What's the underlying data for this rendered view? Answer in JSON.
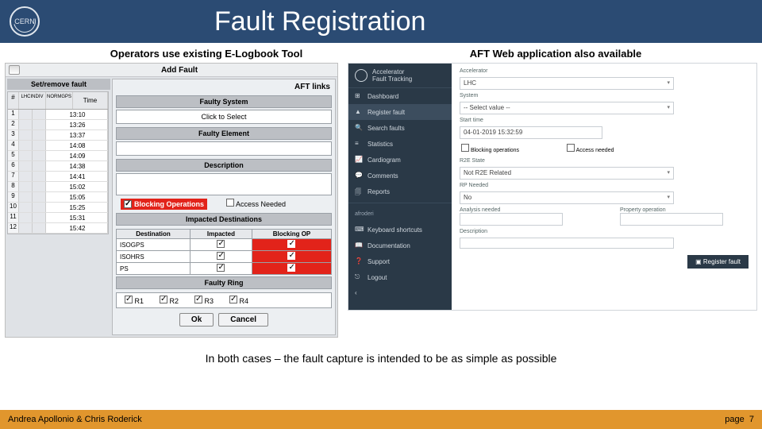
{
  "header": {
    "logo_text": "CERN",
    "title": "Fault Registration"
  },
  "sub": {
    "left": "Operators use existing E-Logbook Tool",
    "right": "AFT Web application also available"
  },
  "elog": {
    "window_title": "Add Fault",
    "aft_links": "AFT links",
    "set_label": "Set/remove fault",
    "grid_head": {
      "num": "#",
      "col1": "LHCINDIV",
      "col2": "NORMGPS",
      "time": "Time"
    },
    "rows": [
      {
        "n": "1",
        "t": "13:10"
      },
      {
        "n": "2",
        "t": "13:26"
      },
      {
        "n": "3",
        "t": "13:37"
      },
      {
        "n": "4",
        "t": "14:08"
      },
      {
        "n": "5",
        "t": "14:09"
      },
      {
        "n": "6",
        "t": "14:38"
      },
      {
        "n": "7",
        "t": "14:41"
      },
      {
        "n": "8",
        "t": "15:02"
      },
      {
        "n": "9",
        "t": "15:05"
      },
      {
        "n": "10",
        "t": "15:25"
      },
      {
        "n": "11",
        "t": "15:31"
      },
      {
        "n": "12",
        "t": "15:42"
      }
    ],
    "faulty_system": "Faulty System",
    "click_select": "Click to Select",
    "faulty_element": "Faulty Element",
    "description": "Description",
    "blocking": "Blocking Operations",
    "access": "Access Needed",
    "impacted": "Impacted Destinations",
    "dest_h": {
      "d": "Destination",
      "i": "Impacted",
      "b": "Blocking OP"
    },
    "dests": [
      "ISOGPS",
      "ISOHRS",
      "PS"
    ],
    "faulty_ring": "Faulty Ring",
    "rings": [
      "R1",
      "R2",
      "R3",
      "R4"
    ],
    "ok": "Ok",
    "cancel": "Cancel"
  },
  "aft": {
    "brand": "Accelerator\nFault Tracking",
    "accel": "LHC",
    "menu": [
      "Dashboard",
      "Register fault",
      "Search faults",
      "Statistics",
      "Cardiogram",
      "Comments",
      "Reports"
    ],
    "user": "afroderi",
    "menu2": [
      "Keyboard shortcuts",
      "Documentation",
      "Support",
      "Logout"
    ],
    "labels": {
      "accelerator": "Accelerator",
      "system": "System",
      "select": "-- Select value --",
      "start": "Start time",
      "start_val": "04-01-2019 15:32:59",
      "block": "Blocking operations",
      "access": "Access needed",
      "r2e": "R2E State",
      "r2e_val": "Not R2E Related",
      "rp": "RP Needed",
      "no": "No",
      "ar": "Analysis needed",
      "po": "Property operation",
      "desc": "Description"
    },
    "register": "Register fault"
  },
  "caption": "In both cases – the fault capture is intended to be as simple as possible",
  "footer": {
    "authors": "Andrea Apollonio & Chris Roderick",
    "page_label": "page",
    "page_num": "7"
  }
}
